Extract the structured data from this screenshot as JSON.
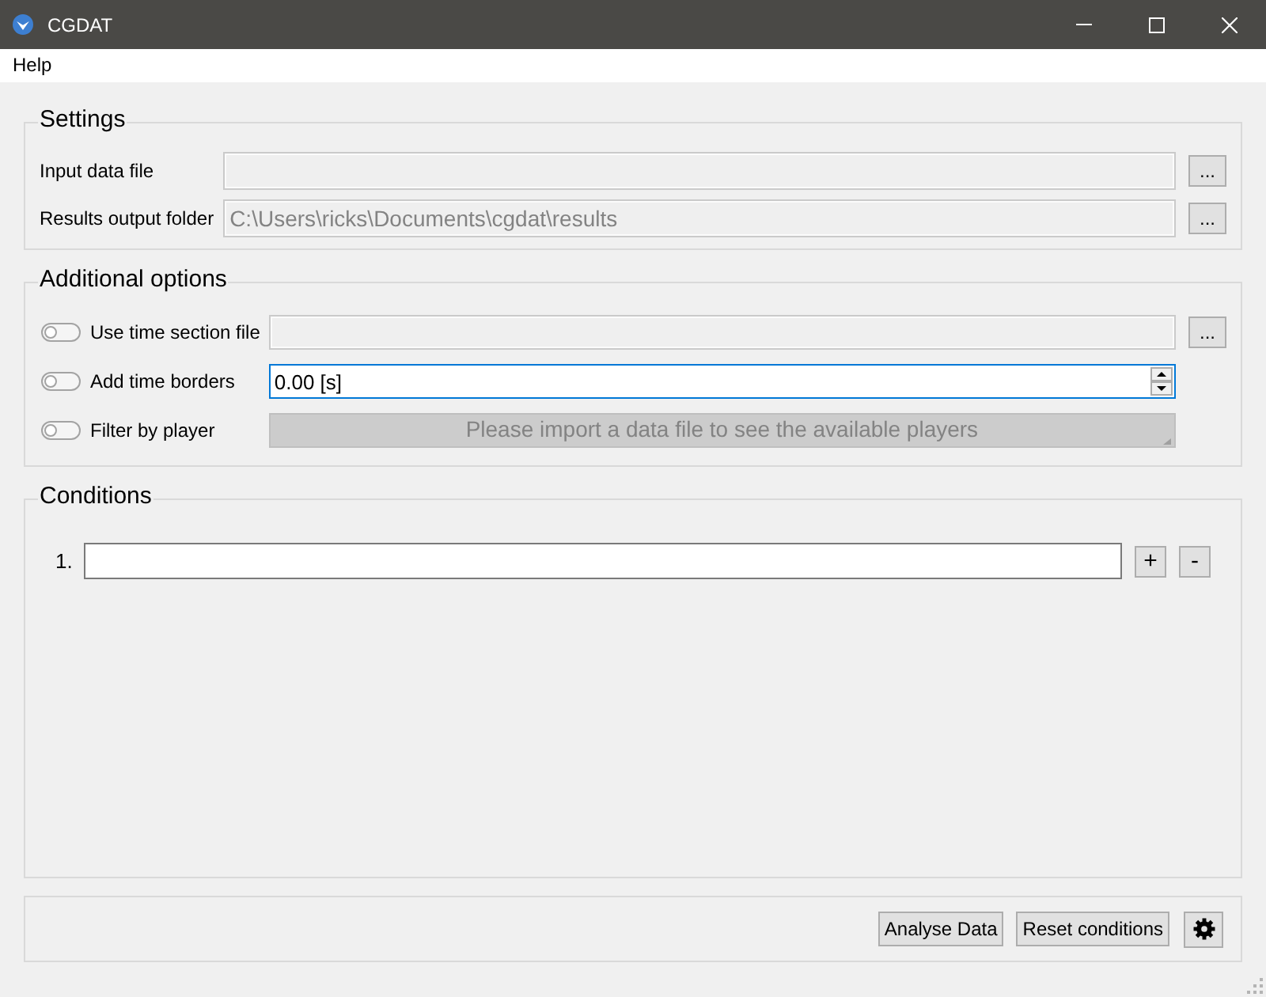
{
  "window": {
    "title": "CGDAT"
  },
  "menu": [
    {
      "label": "Help"
    }
  ],
  "settings": {
    "title": "Settings",
    "rows": [
      {
        "label": "Input data file",
        "disabled": true,
        "browse_button": "..."
      },
      {
        "label": "Results output folder",
        "value": "C:\\Users\\ricks\\Documents\\cgdat\\results",
        "disabled": true,
        "browse_button": "..."
      }
    ]
  },
  "options": {
    "title": "Additional options",
    "rows": [
      {
        "kind": "file",
        "label": "Use time section file",
        "on": false,
        "disabled": true,
        "browse_button": "..."
      },
      {
        "kind": "spin",
        "label": "Add time borders",
        "on": false,
        "value": "0.00 [s]",
        "focused": true
      },
      {
        "kind": "combo",
        "label": "Filter by player",
        "on": false,
        "placeholder": "Please import a data file to see the available players",
        "disabled": true
      }
    ]
  },
  "conditions": {
    "title": "Conditions",
    "items": [
      {
        "number": "1.",
        "add_button": "+",
        "remove_button": "-"
      }
    ]
  },
  "footer": {
    "buttons": [
      {
        "label": "Analyse Data"
      },
      {
        "label": "Reset conditions"
      }
    ]
  }
}
